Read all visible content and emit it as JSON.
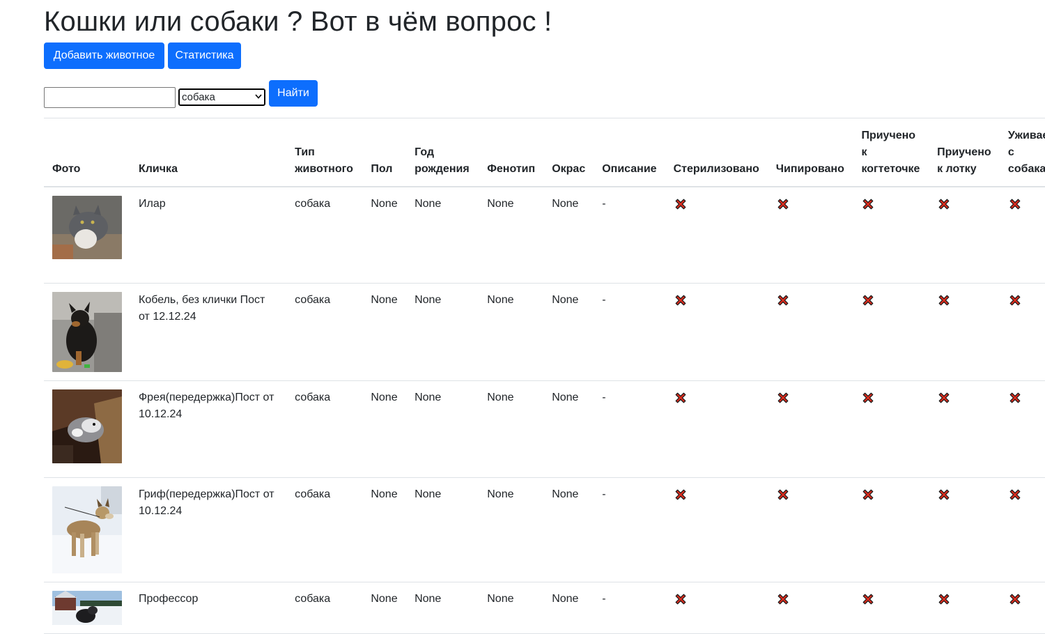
{
  "page": {
    "title": "Кошки или собаки ? Вот в чём вопрос !"
  },
  "toolbar": {
    "add_label": "Добавить животное",
    "stats_label": "Статистика"
  },
  "search": {
    "value": "",
    "select_value": "собака",
    "find_label": "Найти"
  },
  "table": {
    "headers": {
      "photo": "Фото",
      "name": "Кличка",
      "type_l1": "Тип",
      "type_l2": "животного",
      "sex": "Пол",
      "year_l1": "Год",
      "year_l2": "рождения",
      "pheno": "Фенотип",
      "color": "Окрас",
      "desc": "Описание",
      "ster": "Стерилизовано",
      "chip": "Чипировано",
      "claw_l1": "Приучено",
      "claw_l2": "к",
      "claw_l3": "когтеточке",
      "tray_l1": "Приучено",
      "tray_l2": "к лотку",
      "dogs_l1": "Уживается",
      "dogs_l2": "с",
      "dogs_l3": "собаками"
    },
    "rows": [
      {
        "name": "Илар",
        "type": "собака",
        "sex": "None",
        "year": "None",
        "pheno": "None",
        "color": "None",
        "desc": "-",
        "photo_icon": "gray-cat-photo"
      },
      {
        "name": "Кобель, без клички Пост от 12.12.24",
        "type": "собака",
        "sex": "None",
        "year": "None",
        "pheno": "None",
        "color": "None",
        "desc": "-",
        "photo_icon": "black-tan-puppy-photo"
      },
      {
        "name": "Фрея(передержка)Пост от 10.12.24",
        "type": "собака",
        "sex": "None",
        "year": "None",
        "pheno": "None",
        "color": "None",
        "desc": "-",
        "photo_icon": "husky-in-box-photo"
      },
      {
        "name": "Гриф(передержка)Пост от 10.12.24",
        "type": "собака",
        "sex": "None",
        "year": "None",
        "pheno": "None",
        "color": "None",
        "desc": "-",
        "photo_icon": "wolfdog-in-snow-photo"
      },
      {
        "name": "Профессор",
        "type": "собака",
        "sex": "None",
        "year": "None",
        "pheno": "None",
        "color": "None",
        "desc": "-",
        "photo_icon": "dog-snow-house-photo"
      }
    ]
  },
  "colors": {
    "primary": "#0d6efd",
    "xmark_fill": "#d92b1d",
    "text": "#212529",
    "border": "#dee2e6"
  }
}
